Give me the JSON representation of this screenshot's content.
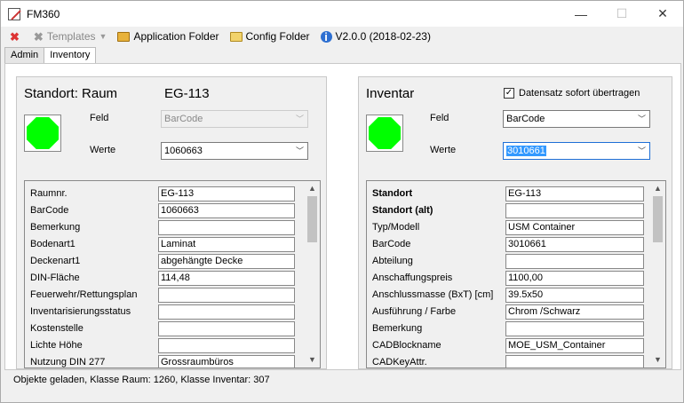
{
  "window": {
    "title": "FM360",
    "minimize": "—",
    "maximize": "☐",
    "close": "✕"
  },
  "toolbar": {
    "templates_label": "Templates",
    "app_folder_label": "Application Folder",
    "config_folder_label": "Config Folder",
    "version_label": "V2.0.0 (2018-02-23)"
  },
  "tabs": [
    {
      "label": "Admin"
    },
    {
      "label": "Inventory"
    }
  ],
  "left": {
    "title": "Standort: Raum",
    "room_id": "EG-113",
    "feld_label": "Feld",
    "feld_value": "BarCode",
    "werte_label": "Werte",
    "werte_value": "1060663",
    "status_color": "#00ff00",
    "rows": [
      {
        "key": "Raumnr.",
        "value": "EG-113"
      },
      {
        "key": "BarCode",
        "value": "1060663"
      },
      {
        "key": "Bemerkung",
        "value": ""
      },
      {
        "key": "Bodenart1",
        "value": "Laminat"
      },
      {
        "key": "Deckenart1",
        "value": "abgehängte Decke"
      },
      {
        "key": "DIN-Fläche",
        "value": "114,48"
      },
      {
        "key": "Feuerwehr/Rettungsplan",
        "value": ""
      },
      {
        "key": "Inventarisierungsstatus",
        "value": ""
      },
      {
        "key": "Kostenstelle",
        "value": ""
      },
      {
        "key": "Lichte Höhe",
        "value": ""
      },
      {
        "key": "Nutzung DIN 277",
        "value": "Grossraumbüros"
      }
    ]
  },
  "right": {
    "title": "Inventar",
    "sofort_label": "Datensatz sofort übertragen",
    "sofort_checked": "✓",
    "feld_label": "Feld",
    "feld_value": "BarCode",
    "werte_label": "Werte",
    "werte_value": "3010661",
    "status_color": "#00ff00",
    "rows": [
      {
        "key": "Standort",
        "value": "EG-113"
      },
      {
        "key": "Standort (alt)",
        "value": ""
      },
      {
        "key": "Typ/Modell",
        "value": "USM Container"
      },
      {
        "key": "BarCode",
        "value": "3010661"
      },
      {
        "key": "Abteilung",
        "value": ""
      },
      {
        "key": "Anschaffungspreis",
        "value": "1100,00"
      },
      {
        "key": "Anschlussmasse (BxT) [cm]",
        "value": "39.5x50"
      },
      {
        "key": "Ausführung / Farbe",
        "value": "Chrom /Schwarz"
      },
      {
        "key": "Bemerkung",
        "value": ""
      },
      {
        "key": "CADBlockname",
        "value": "MOE_USM_Container"
      },
      {
        "key": "CADKeyAttr.",
        "value": ""
      }
    ]
  },
  "status": {
    "text": "Objekte geladen, Klasse Raum: 1260, Klasse Inventar: 307"
  }
}
